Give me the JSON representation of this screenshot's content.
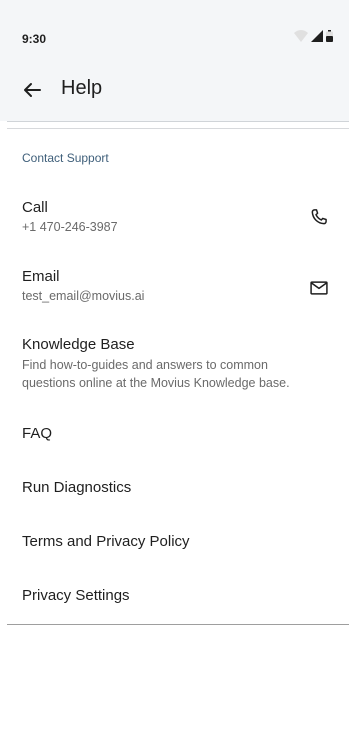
{
  "status": {
    "time": "9:30"
  },
  "header": {
    "title": "Help"
  },
  "section": {
    "label": "Contact Support"
  },
  "items": {
    "call": {
      "title": "Call",
      "subtitle": "+1 470-246-3987"
    },
    "email": {
      "title": "Email",
      "subtitle": "test_email@movius.ai"
    },
    "knowledge": {
      "title": "Knowledge Base",
      "line1": "Find how-to-guides and answers to common",
      "line2": "questions online at the Movius Knowledge base."
    },
    "faq": {
      "title": "FAQ"
    },
    "diagnostics": {
      "title": "Run Diagnostics"
    },
    "terms": {
      "title": "Terms and Privacy Policy"
    },
    "privacy": {
      "title": "Privacy Settings"
    }
  },
  "icons": {
    "back": "arrow-back-icon",
    "call": "phone-icon",
    "email": "mail-icon",
    "wifi": "wifi-icon",
    "signal": "signal-icon",
    "battery": "battery-icon"
  }
}
